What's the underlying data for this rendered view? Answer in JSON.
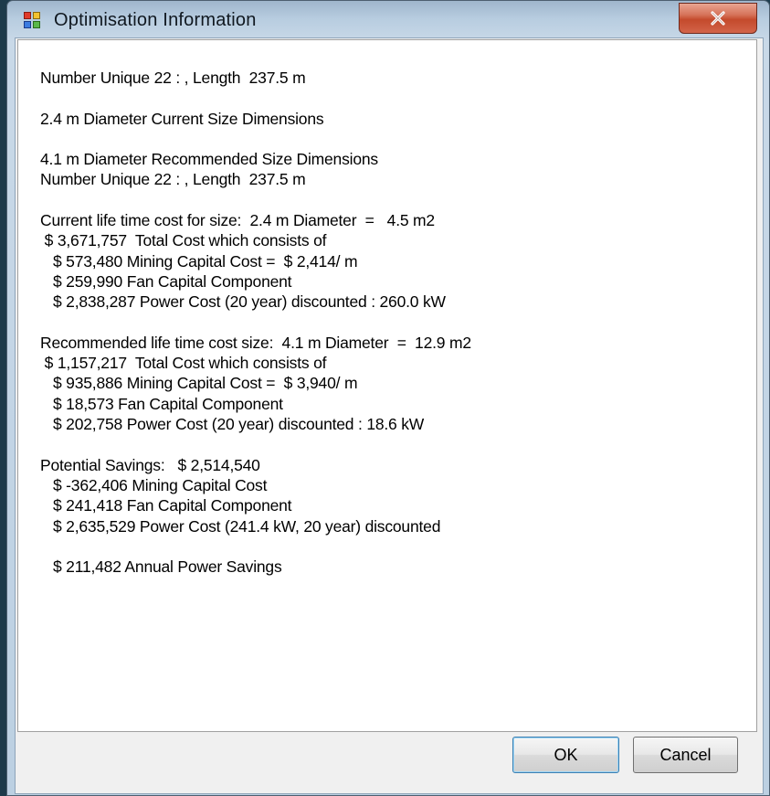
{
  "window": {
    "title": "Optimisation Information",
    "app_icon": "form-icon",
    "close_icon": "close-icon"
  },
  "info_lines": [
    "Number Unique 22 : , Length  237.5 m",
    "",
    "2.4 m Diameter Current Size Dimensions",
    "",
    "4.1 m Diameter Recommended Size Dimensions",
    "Number Unique 22 : , Length  237.5 m",
    "",
    "Current life time cost for size:  2.4 m Diameter  =   4.5 m2",
    " $ 3,671,757  Total Cost which consists of",
    "   $ 573,480 Mining Capital Cost =  $ 2,414/ m",
    "   $ 259,990 Fan Capital Component",
    "   $ 2,838,287 Power Cost (20 year) discounted : 260.0 kW",
    "",
    "Recommended life time cost size:  4.1 m Diameter  =  12.9 m2",
    " $ 1,157,217  Total Cost which consists of",
    "   $ 935,886 Mining Capital Cost =  $ 3,940/ m",
    "   $ 18,573 Fan Capital Component",
    "   $ 202,758 Power Cost (20 year) discounted : 18.6 kW",
    "",
    "Potential Savings:   $ 2,514,540",
    "   $ -362,406 Mining Capital Cost",
    "   $ 241,418 Fan Capital Component",
    "   $ 2,635,529 Power Cost (241.4 kW, 20 year) discounted",
    "",
    "   $ 211,482 Annual Power Savings"
  ],
  "buttons": {
    "ok_label": "OK",
    "cancel_label": "Cancel"
  },
  "colors": {
    "close_button": "#c44a2c",
    "title_bar": "#b8cde0",
    "dialog_background": "#f0f0f0",
    "text_background": "#ffffff",
    "ok_focus_border": "#3c7fb1"
  }
}
